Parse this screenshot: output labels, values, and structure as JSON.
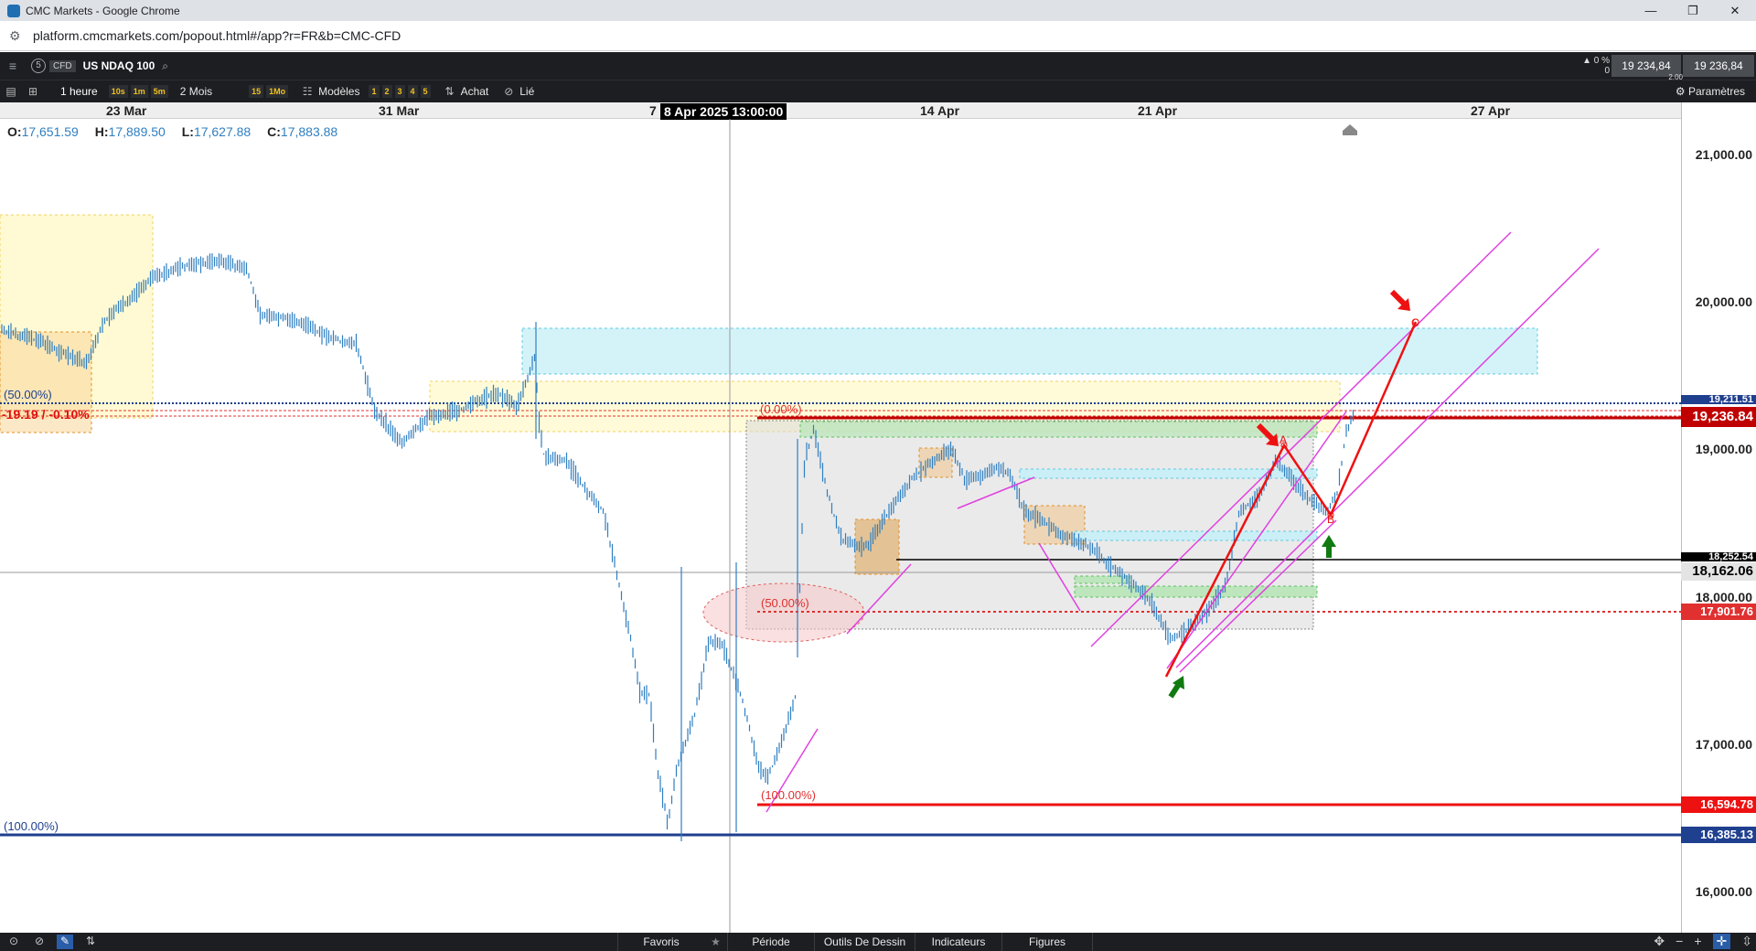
{
  "browser": {
    "window_title": "CMC Markets - Google Chrome",
    "url": "platform.cmcmarkets.com/popout.html#/app?r=FR&b=CMC-CFD",
    "controls": [
      "—",
      "❐",
      "✕"
    ]
  },
  "header": {
    "badge_number": "5",
    "cfd_tag": "CFD",
    "instrument": "US NDAQ 100",
    "spread_change": "▲ 0 %",
    "spread_value": "0",
    "sell_price": "19 234,84",
    "buy_price": "19 236,84",
    "spread_mini": "2,00"
  },
  "toolbar": {
    "period": "1 heure",
    "timeframes_left": [
      "10s",
      "1m",
      "5m"
    ],
    "range": "2 Mois",
    "timeframes_right": [
      "15",
      "1Mo"
    ],
    "models": "Modèles",
    "layout_counts": [
      "1",
      "2",
      "3",
      "4",
      "5"
    ],
    "buy": "Achat",
    "linked": "Lié",
    "settings": "Paramètres"
  },
  "date_axis": {
    "labels": [
      "23 Mar",
      "31 Mar",
      "7",
      "14 Apr",
      "21 Apr",
      "27 Apr"
    ],
    "crosshair_date": "8 Apr 2025 13:00:00"
  },
  "ohlc": {
    "open_label": "O:",
    "open": "17,651.59",
    "high_label": "H:",
    "high": "17,889.50",
    "low_label": "L:",
    "low": "17,627.88",
    "close_label": "C:",
    "close": "17,883.88"
  },
  "chart_labels": {
    "fib_50_left": "(50.00%)",
    "fib_100_left": "(100.00%)",
    "change_text": "-19.19 / -0.10%",
    "fib_0": "(0.00%)",
    "fib_50_mid": "(50.00%)",
    "fib_100_mid": "(100.00%)",
    "wave_a": "A",
    "wave_b": "B",
    "wave_c": "C"
  },
  "price_axis": {
    "ticks": [
      "21,000.00",
      "20,000.00",
      "19,000.00",
      "18,000.00",
      "17,000.00",
      "16,000.00"
    ],
    "tag_current": "19,236.84",
    "tag_crosshair": "18,162.06",
    "tag_black_line": "18,252.54",
    "tag_dotted_top": "19,211.51",
    "tag_red_dotted": "17,901.76",
    "tag_red_low": "16,594.78",
    "tag_blue_low": "16,385.13"
  },
  "bottom_bar": {
    "favoris": "Favoris",
    "star": "★",
    "periode": "Période",
    "outils": "Outils De Dessin",
    "indicateurs": "Indicateurs",
    "figures": "Figures"
  },
  "colors": {
    "current_price": "#c00000",
    "blue_level": "#1f3f8f",
    "fib_magenta": "#e040e0",
    "wave_red": "#ee1111",
    "up_arrow": "#107a10"
  }
}
